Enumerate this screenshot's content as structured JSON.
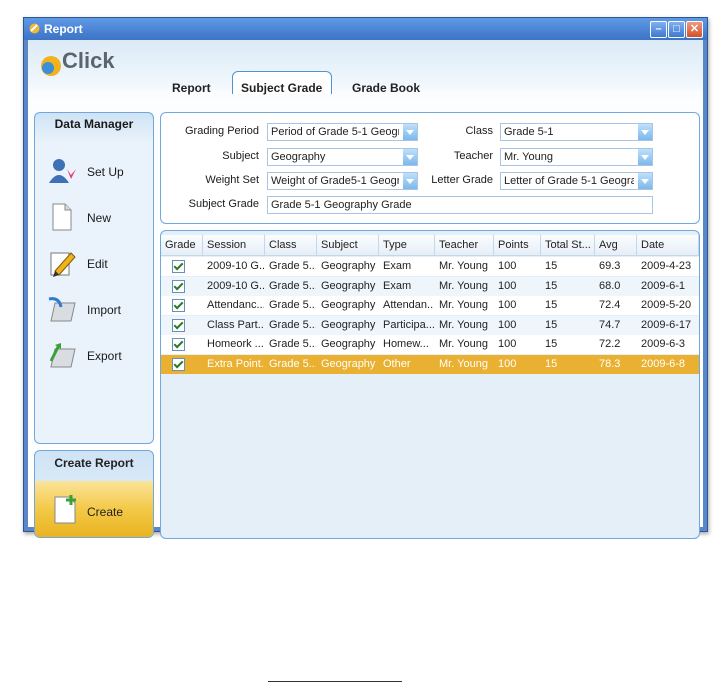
{
  "window": {
    "title": "Report"
  },
  "header": {
    "logo_text": "Click"
  },
  "tabs": [
    {
      "label": "Report",
      "active": false
    },
    {
      "label": "Subject Grade",
      "active": true
    },
    {
      "label": "Grade Book",
      "active": false
    }
  ],
  "sidebar": {
    "heading": "Data Manager",
    "items": [
      {
        "label": "Set Up",
        "icon": "setup-icon"
      },
      {
        "label": "New",
        "icon": "new-document-icon"
      },
      {
        "label": "Edit",
        "icon": "edit-icon"
      },
      {
        "label": "Import",
        "icon": "import-icon"
      },
      {
        "label": "Export",
        "icon": "export-icon"
      }
    ]
  },
  "create_report": {
    "heading": "Create Report",
    "button_label": "Create"
  },
  "form": {
    "grading_period": {
      "label": "Grading Period",
      "value": "Period  of Grade 5-1 Geogra"
    },
    "class": {
      "label": "Class",
      "value": "Grade 5-1"
    },
    "subject": {
      "label": "Subject",
      "value": "Geography"
    },
    "teacher": {
      "label": "Teacher",
      "value": "Mr. Young"
    },
    "weight_set": {
      "label": "Weight Set",
      "value": "Weight of Grade5-1 Geogra"
    },
    "letter_grade": {
      "label": "Letter Grade",
      "value": "Letter of Grade 5-1 Geograp"
    },
    "subject_grade": {
      "label": "Subject Grade",
      "value": "Grade 5-1 Geography Grade"
    }
  },
  "grid": {
    "columns": [
      "Grade",
      "Session",
      "Class",
      "Subject",
      "Type",
      "Teacher",
      "Points",
      "Total St...",
      "Avg",
      "Date"
    ],
    "rows": [
      [
        "",
        "2009-10 G...",
        "Grade 5...",
        "Geography",
        "Exam",
        "Mr. Young",
        "100",
        "15",
        "69.3",
        "2009-4-23"
      ],
      [
        "",
        "2009-10 G...",
        "Grade 5...",
        "Geography",
        "Exam",
        "Mr. Young",
        "100",
        "15",
        "68.0",
        "2009-6-1"
      ],
      [
        "",
        "Attendanc...",
        "Grade 5...",
        "Geography",
        "Attendan...",
        "Mr. Young",
        "100",
        "15",
        "72.4",
        "2009-5-20"
      ],
      [
        "",
        "Class Part...",
        "Grade 5...",
        "Geography",
        "Participa...",
        "Mr. Young",
        "100",
        "15",
        "74.7",
        "2009-6-17"
      ],
      [
        "",
        "Homeork ...",
        "Grade 5...",
        "Geography",
        "Homew...",
        "Mr. Young",
        "100",
        "15",
        "72.2",
        "2009-6-3"
      ],
      [
        "",
        "Extra Point...",
        "Grade 5...",
        "Geography",
        "Other",
        "Mr. Young",
        "100",
        "15",
        "78.3",
        "2009-6-8"
      ]
    ],
    "selected_row": 5
  },
  "colors": {
    "selection": "#e9b031",
    "accent": "#4b94d6",
    "title_bar": "#3c73c6"
  }
}
